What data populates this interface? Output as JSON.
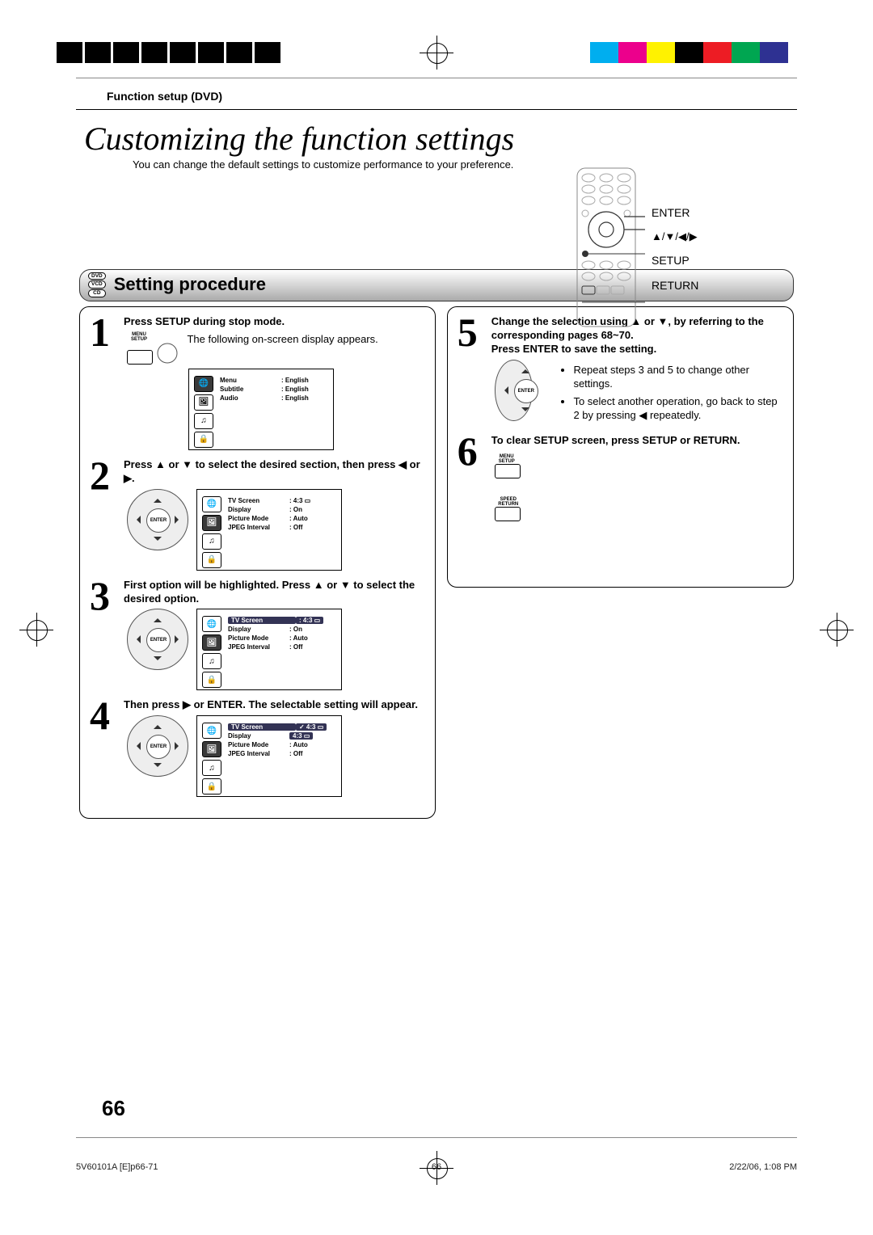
{
  "header": {
    "section": "Function setup (DVD)"
  },
  "title": {
    "main": "Customizing the function settings",
    "sub": "You can change the default settings to customize performance to your preference."
  },
  "remote": {
    "labels": [
      "ENTER",
      "▲/▼/◀/▶",
      "SETUP",
      "RETURN"
    ]
  },
  "discs": [
    "DVD",
    "VCD",
    "CD"
  ],
  "procedure_title": "Setting procedure",
  "steps": {
    "s1": {
      "head": "Press SETUP during stop mode.",
      "text": "The following on-screen display appears.",
      "btn": "MENU SETUP",
      "osd": [
        {
          "label": "Menu",
          "value": ": English"
        },
        {
          "label": "Subtitle",
          "value": ": English"
        },
        {
          "label": "Audio",
          "value": ": English"
        }
      ]
    },
    "s2": {
      "head": "Press ▲ or ▼ to select the desired section, then press ◀ or ▶.",
      "dpad": "ENTER",
      "osd": [
        {
          "label": "TV Screen",
          "value": ": 4:3 ▭"
        },
        {
          "label": "Display",
          "value": ": On"
        },
        {
          "label": "Picture Mode",
          "value": ": Auto"
        },
        {
          "label": "JPEG Interval",
          "value": ": Off"
        }
      ]
    },
    "s3": {
      "head": "First option will be highlighted. Press ▲ or ▼ to select the desired option.",
      "dpad": "ENTER",
      "osd": [
        {
          "label": "TV Screen",
          "value": ": 4:3 ▭",
          "hl": true
        },
        {
          "label": "Display",
          "value": ": On"
        },
        {
          "label": "Picture Mode",
          "value": ": Auto"
        },
        {
          "label": "JPEG Interval",
          "value": ": Off"
        }
      ]
    },
    "s4": {
      "head": "Then press ▶ or ENTER. The selectable setting will appear.",
      "dpad": "ENTER",
      "osd": [
        {
          "label": "TV Screen",
          "value": "✓ 4:3 ▭",
          "hl": true,
          "hlval": true
        },
        {
          "label": "Display",
          "value": "4:3 ▭",
          "hlval": true
        },
        {
          "label": "Picture Mode",
          "value": ": Auto"
        },
        {
          "label": "JPEG Interval",
          "value": ": Off"
        }
      ]
    },
    "s5": {
      "head_a": "Change the selection using ▲ or ▼, by referring to the corresponding pages 68~70.",
      "head_b": "Press ENTER to save the setting.",
      "dpad": "ENTER",
      "bullets": [
        "Repeat steps 3 and 5 to change other settings.",
        "To select another operation, go back to step 2 by pressing ◀ repeatedly."
      ]
    },
    "s6": {
      "head": "To clear SETUP screen, press SETUP or RETURN.",
      "btn1": "MENU SETUP",
      "btn2": "SPEED RETURN"
    }
  },
  "page_number": "66",
  "footer": {
    "left": "5V60101A [E]p66-71",
    "center": "66",
    "right": "2/22/06, 1:08 PM"
  },
  "icons": {
    "globe": "🌐",
    "pic": "🖼",
    "audio": "♫",
    "lock": "🔒"
  },
  "crop_colors": [
    "#00aeef",
    "#ec008c",
    "#fff200",
    "#000000",
    "#ed1c24",
    "#00a651",
    "#2e3192",
    "#ffffff"
  ]
}
